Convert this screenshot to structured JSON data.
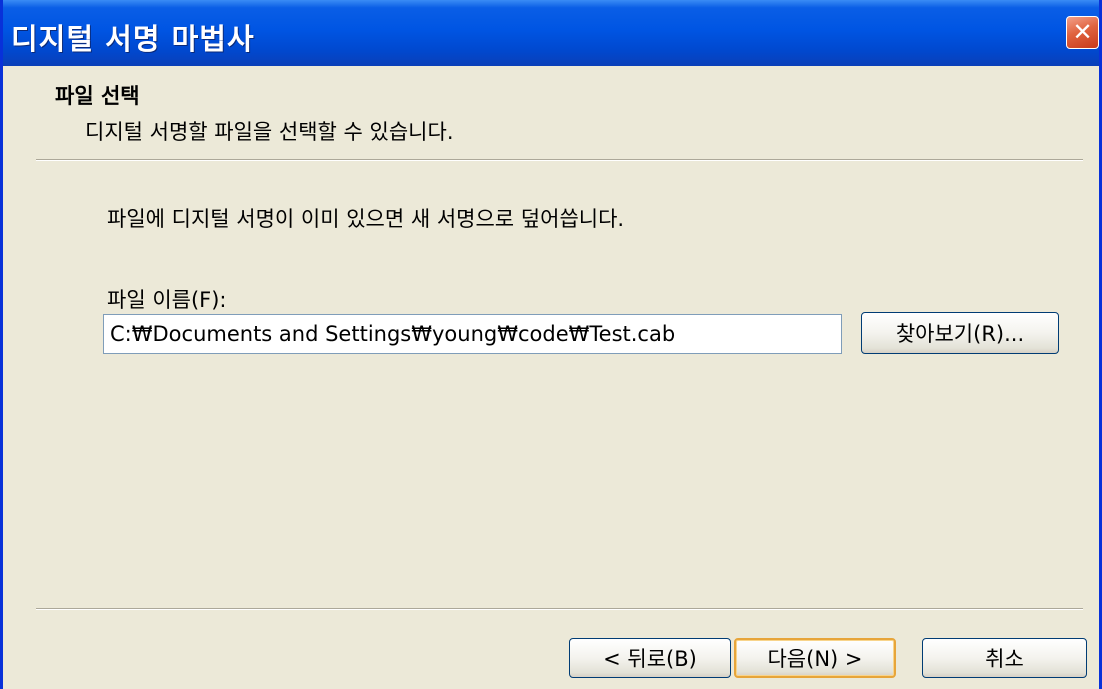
{
  "window": {
    "title": "디지털 서명 마법사",
    "close_symbol": "✕",
    "colors": {
      "titlebar": "#0055e3",
      "face": "#ece9d8",
      "close_button": "#e0633f"
    }
  },
  "header": {
    "title": "파일 선택",
    "description": "디지털 서명할 파일을 선택할 수 있습니다."
  },
  "content": {
    "info_text": "파일에 디지털 서명이 이미 있으면 새 서명으로 덮어씁니다.",
    "file_label": "파일 이름(F):",
    "file_value": "C:₩Documents and Settings₩young₩code₩Test.cab",
    "browse_label": "찾아보기(R)..."
  },
  "footer": {
    "back_label": "< 뒤로(B)",
    "next_label": "다음(N) >",
    "cancel_label": "취소"
  }
}
